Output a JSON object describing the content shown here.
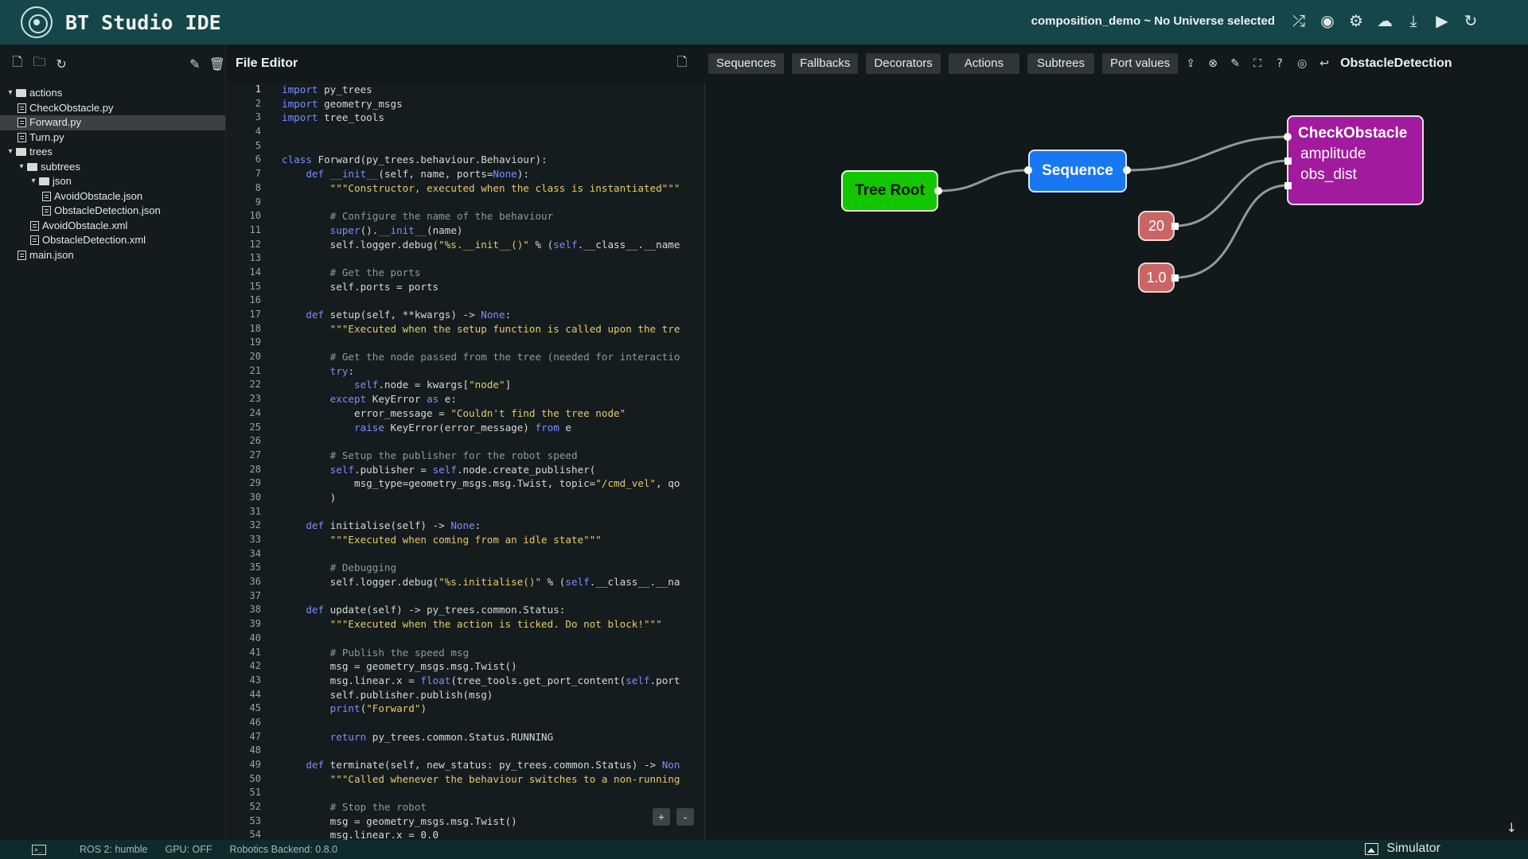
{
  "app": {
    "title": "BT Studio IDE",
    "project_status": "composition_demo ~ No Universe selected"
  },
  "top_icons": [
    "shuffle-icon",
    "globe-icon",
    "gear-icon",
    "cloud-upload-icon",
    "download-icon",
    "play-icon",
    "refresh-icon"
  ],
  "sidebar": {
    "tools": [
      "new-file-icon",
      "new-folder-icon",
      "refresh-icon",
      "edit-icon",
      "trash-icon"
    ],
    "tree": [
      {
        "label": "actions",
        "type": "folder",
        "depth": 0,
        "open": true
      },
      {
        "label": "CheckObstacle.py",
        "type": "file",
        "depth": 1
      },
      {
        "label": "Forward.py",
        "type": "file",
        "depth": 1,
        "selected": true
      },
      {
        "label": "Turn.py",
        "type": "file",
        "depth": 1
      },
      {
        "label": "trees",
        "type": "folder",
        "depth": 0,
        "open": true
      },
      {
        "label": "subtrees",
        "type": "folder",
        "depth": 1,
        "open": true
      },
      {
        "label": "json",
        "type": "folder",
        "depth": 2,
        "open": true
      },
      {
        "label": "AvoidObstacle.json",
        "type": "file",
        "depth": 3
      },
      {
        "label": "ObstacleDetection.json",
        "type": "file",
        "depth": 3
      },
      {
        "label": "AvoidObstacle.xml",
        "type": "file",
        "depth": 2
      },
      {
        "label": "ObstacleDetection.xml",
        "type": "file",
        "depth": 2
      },
      {
        "label": "main.json",
        "type": "file",
        "depth": 1
      }
    ]
  },
  "editor": {
    "title": "File Editor",
    "current_line": 1,
    "lines": [
      [
        [
          "kw",
          "import"
        ],
        [
          "t",
          " py_trees"
        ]
      ],
      [
        [
          "kw",
          "import"
        ],
        [
          "t",
          " geometry_msgs"
        ]
      ],
      [
        [
          "kw",
          "import"
        ],
        [
          "t",
          " tree_tools"
        ]
      ],
      [],
      [],
      [
        [
          "kw",
          "class"
        ],
        [
          "t",
          " Forward(py_trees.behaviour.Behaviour):"
        ]
      ],
      [
        [
          "t",
          "    "
        ],
        [
          "kw",
          "def"
        ],
        [
          "t",
          " "
        ],
        [
          "kw",
          "__init__"
        ],
        [
          "t",
          "(self, name, ports="
        ],
        [
          "kw",
          "None"
        ],
        [
          "t",
          "):"
        ]
      ],
      [
        [
          "t",
          "        "
        ],
        [
          "str",
          "\"\"\"Constructor, executed when the class is instantiated\"\"\""
        ]
      ],
      [],
      [
        [
          "t",
          "        "
        ],
        [
          "cm",
          "# Configure the name of the behaviour"
        ]
      ],
      [
        [
          "t",
          "        "
        ],
        [
          "kw",
          "super"
        ],
        [
          "t",
          "()."
        ],
        [
          "kw",
          "__init__"
        ],
        [
          "t",
          "(name)"
        ]
      ],
      [
        [
          "t",
          "        self.logger.debug("
        ],
        [
          "str",
          "\"%s.__init__()\""
        ],
        [
          "t",
          " % ("
        ],
        [
          "kw",
          "self"
        ],
        [
          "t",
          ".__class__.__name"
        ]
      ],
      [],
      [
        [
          "t",
          "        "
        ],
        [
          "cm",
          "# Get the ports"
        ]
      ],
      [
        [
          "t",
          "        self.ports = ports"
        ]
      ],
      [],
      [
        [
          "t",
          "    "
        ],
        [
          "kw",
          "def"
        ],
        [
          "t",
          " setup(self, **kwargs) -> "
        ],
        [
          "kw",
          "None"
        ],
        [
          "t",
          ":"
        ]
      ],
      [
        [
          "t",
          "        "
        ],
        [
          "str",
          "\"\"\"Executed when the setup function is called upon the tre"
        ]
      ],
      [],
      [
        [
          "t",
          "        "
        ],
        [
          "cm",
          "# Get the node passed from the tree (needed for interactio"
        ]
      ],
      [
        [
          "t",
          "        "
        ],
        [
          "kw",
          "try"
        ],
        [
          "t",
          ":"
        ]
      ],
      [
        [
          "t",
          "            "
        ],
        [
          "kw",
          "self"
        ],
        [
          "t",
          ".node = kwargs["
        ],
        [
          "str",
          "\"node\""
        ],
        [
          "t",
          "]"
        ]
      ],
      [
        [
          "t",
          "        "
        ],
        [
          "kw",
          "except"
        ],
        [
          "t",
          " KeyError "
        ],
        [
          "kw",
          "as"
        ],
        [
          "t",
          " e:"
        ]
      ],
      [
        [
          "t",
          "            error_message = "
        ],
        [
          "str",
          "\"Couldn't find the tree node\""
        ]
      ],
      [
        [
          "t",
          "            "
        ],
        [
          "kw",
          "raise"
        ],
        [
          "t",
          " KeyError(error_message) "
        ],
        [
          "kw",
          "from"
        ],
        [
          "t",
          " e"
        ]
      ],
      [],
      [
        [
          "t",
          "        "
        ],
        [
          "cm",
          "# Setup the publisher for the robot speed"
        ]
      ],
      [
        [
          "t",
          "        "
        ],
        [
          "kw",
          "self"
        ],
        [
          "t",
          ".publisher = "
        ],
        [
          "kw",
          "self"
        ],
        [
          "t",
          ".node.create_publisher("
        ]
      ],
      [
        [
          "t",
          "            msg_type=geometry_msgs.msg.Twist, topic="
        ],
        [
          "str",
          "\"/cmd_vel\""
        ],
        [
          "t",
          ", qo"
        ]
      ],
      [
        [
          "t",
          "        )"
        ]
      ],
      [],
      [
        [
          "t",
          "    "
        ],
        [
          "kw",
          "def"
        ],
        [
          "t",
          " initialise(self) -> "
        ],
        [
          "kw",
          "None"
        ],
        [
          "t",
          ":"
        ]
      ],
      [
        [
          "t",
          "        "
        ],
        [
          "str",
          "\"\"\"Executed when coming from an idle state\"\"\""
        ]
      ],
      [],
      [
        [
          "t",
          "        "
        ],
        [
          "cm",
          "# Debugging"
        ]
      ],
      [
        [
          "t",
          "        self.logger.debug("
        ],
        [
          "str",
          "\"%s.initialise()\""
        ],
        [
          "t",
          " % ("
        ],
        [
          "kw",
          "self"
        ],
        [
          "t",
          ".__class__.__na"
        ]
      ],
      [],
      [
        [
          "t",
          "    "
        ],
        [
          "kw",
          "def"
        ],
        [
          "t",
          " update(self) -> py_trees.common.Status:"
        ]
      ],
      [
        [
          "t",
          "        "
        ],
        [
          "str",
          "\"\"\"Executed when the action is ticked. Do not block!\"\"\""
        ]
      ],
      [],
      [
        [
          "t",
          "        "
        ],
        [
          "cm",
          "# Publish the speed msg"
        ]
      ],
      [
        [
          "t",
          "        msg = geometry_msgs.msg.Twist()"
        ]
      ],
      [
        [
          "t",
          "        msg.linear.x = "
        ],
        [
          "kw",
          "float"
        ],
        [
          "t",
          "(tree_tools.get_port_content("
        ],
        [
          "kw",
          "self"
        ],
        [
          "t",
          ".port"
        ]
      ],
      [
        [
          "t",
          "        self.publisher.publish(msg)"
        ]
      ],
      [
        [
          "t",
          "        "
        ],
        [
          "kw",
          "print"
        ],
        [
          "t",
          "("
        ],
        [
          "str",
          "\"Forward\""
        ],
        [
          "t",
          ")"
        ]
      ],
      [],
      [
        [
          "t",
          "        "
        ],
        [
          "kw",
          "return"
        ],
        [
          "t",
          " py_trees.common.Status.RUNNING"
        ]
      ],
      [],
      [
        [
          "t",
          "    "
        ],
        [
          "kw",
          "def"
        ],
        [
          "t",
          " terminate(self, new_status: py_trees.common.Status) -> "
        ],
        [
          "kw",
          "Non"
        ]
      ],
      [
        [
          "t",
          "        "
        ],
        [
          "str",
          "\"\"\"Called whenever the behaviour switches to a non-running"
        ]
      ],
      [],
      [
        [
          "t",
          "        "
        ],
        [
          "cm",
          "# Stop the robot"
        ]
      ],
      [
        [
          "t",
          "        msg = geometry_msgs.msg.Twist()"
        ]
      ],
      [
        [
          "t",
          "        msg.linear.x = 0.0"
        ]
      ]
    ],
    "zoom_in": "+",
    "zoom_out": "-"
  },
  "toolbar": {
    "buttons": [
      "Sequences",
      "Fallbacks",
      "Decorators",
      "Actions",
      "Subtrees",
      "Port values"
    ],
    "icons": [
      "upload-icon",
      "close-circle-icon",
      "edit-icon",
      "fullscreen-icon",
      "help-icon",
      "eye-icon",
      "return-icon"
    ],
    "tree_name": "ObstacleDetection"
  },
  "graph": {
    "root_label": "Tree Root",
    "sequence_label": "Sequence",
    "check_label": "CheckObstacle",
    "port_amplitude": "amplitude",
    "port_obs_dist": "obs_dist",
    "value_amplitude": "20",
    "value_obs_dist": "1.0",
    "colors": {
      "root": "#13c600",
      "sequence": "#1877f2",
      "action": "#a21a9e",
      "value": "#c96565"
    }
  },
  "status": {
    "ros": "ROS 2: humble",
    "gpu": "GPU: OFF",
    "backend": "Robotics Backend: 0.8.0",
    "simulator": "Simulator"
  }
}
